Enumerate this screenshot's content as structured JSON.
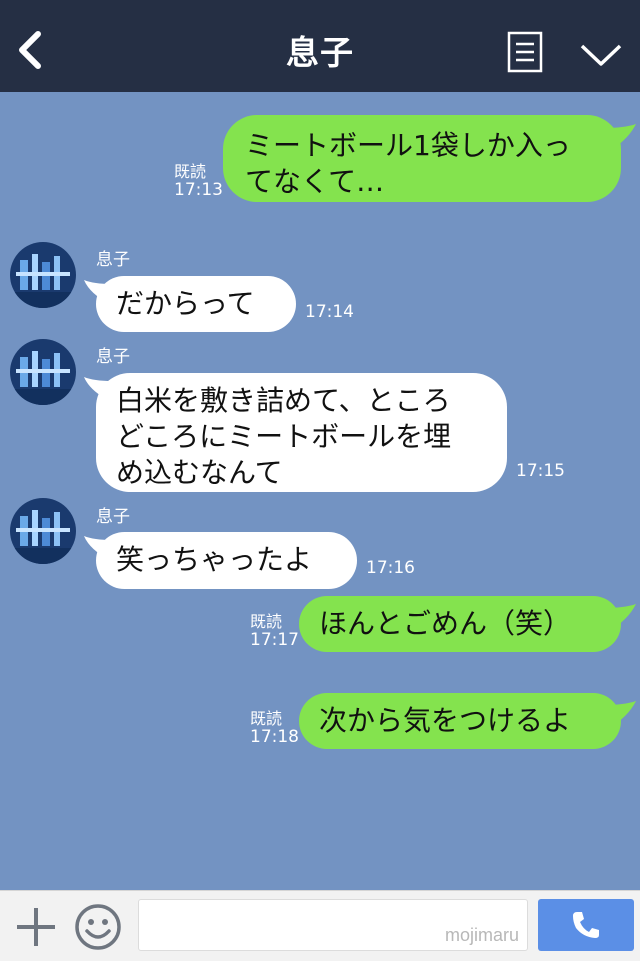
{
  "header": {
    "title": "息子",
    "back_icon": "chevron-left-icon",
    "menu_icon": "list-icon",
    "collapse_icon": "chevron-down-icon"
  },
  "messages": [
    {
      "side": "mine",
      "text_lines": [
        "ミートボール1袋しか入っ",
        "てなくて…"
      ],
      "read": "既読",
      "time": "17:13"
    },
    {
      "side": "theirs",
      "sender": "息子",
      "text_lines": [
        "だからって"
      ],
      "time": "17:14"
    },
    {
      "side": "theirs",
      "sender": "息子",
      "text_lines": [
        "白米を敷き詰めて、ところ",
        "どころにミートボールを埋",
        "め込むなんて"
      ],
      "time": "17:15"
    },
    {
      "side": "theirs",
      "sender": "息子",
      "text_lines": [
        "笑っちゃったよ"
      ],
      "time": "17:16"
    },
    {
      "side": "mine",
      "text_lines": [
        "ほんとごめん（笑）"
      ],
      "read": "既読",
      "time": "17:17"
    },
    {
      "side": "mine",
      "text_lines": [
        "次から気をつけるよ"
      ],
      "read": "既読",
      "time": "17:18"
    }
  ],
  "footer": {
    "plus_icon": "plus-icon",
    "emoji_icon": "smile-icon",
    "input_value": "",
    "watermark": "mojimaru",
    "send_icon": "phone-icon"
  },
  "colors": {
    "chat_background": "#7393c2",
    "header_background": "#252f44",
    "my_bubble": "#84e34e",
    "their_bubble": "#ffffff",
    "send_button": "#5b8fe6"
  }
}
